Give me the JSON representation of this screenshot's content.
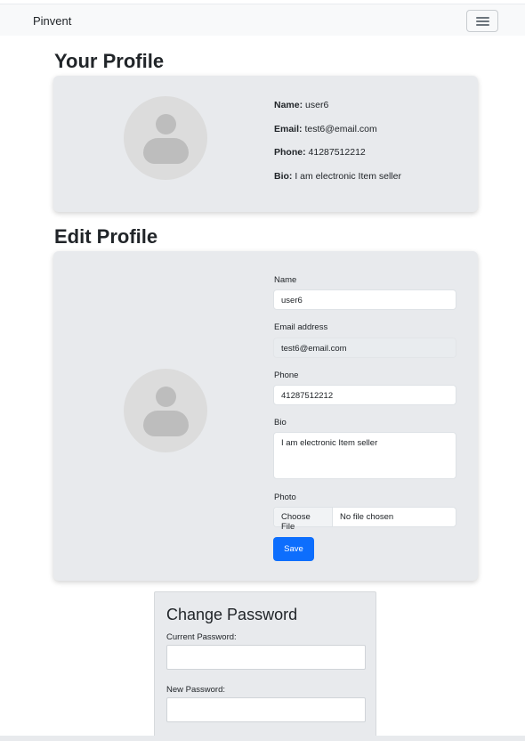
{
  "navbar": {
    "brand": "Pinvent",
    "toggler_icon": "hamburger-icon"
  },
  "profile": {
    "title": "Your Profile",
    "fields": [
      {
        "label": "Name:",
        "value": "user6"
      },
      {
        "label": "Email:",
        "value": "test6@email.com"
      },
      {
        "label": "Phone:",
        "value": "41287512212"
      },
      {
        "label": "Bio:",
        "value": "I am electronic Item seller"
      }
    ]
  },
  "edit": {
    "title": "Edit Profile",
    "name_label": "Name",
    "name_value": "user6",
    "email_label": "Email address",
    "email_value": "test6@email.com",
    "phone_label": "Phone",
    "phone_value": "41287512212",
    "bio_label": "Bio",
    "bio_value": "I am electronic Item seller",
    "photo_label": "Photo",
    "file_button": "Choose File",
    "file_status": "No file chosen",
    "save_label": "Save"
  },
  "password": {
    "title": "Change Password",
    "current_label": "Current Password:",
    "new_label": "New Password:"
  },
  "colors": {
    "primary": "#0d6efd",
    "card_bg": "#e8eaed",
    "avatar": "#dcdcdc"
  }
}
